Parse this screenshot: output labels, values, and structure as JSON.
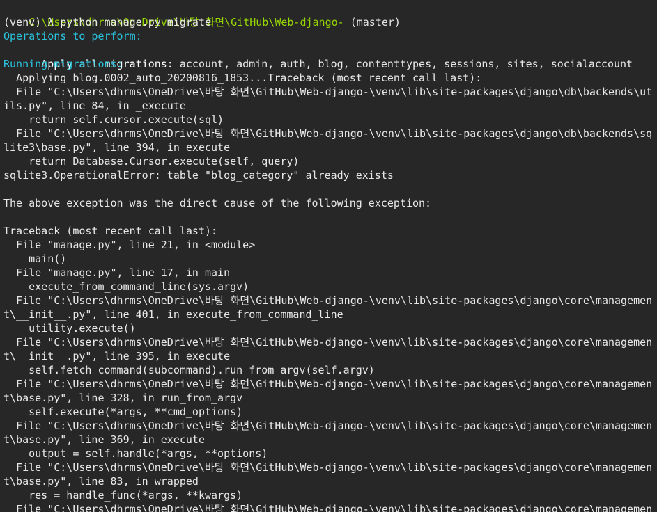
{
  "prompt": {
    "path": "C:\\Users\\dhrms\\OneDrive\\바탕 화면\\GitHub\\Web-django-",
    "branch": " (master)",
    "command": "(venv) λ python manage.py migrate"
  },
  "operations": {
    "heading": "Operations to perform:",
    "apply_label": "  Apply all migrations:",
    "apply_list": " account, admin, auth, blog, contenttypes, sessions, sites, socialaccount"
  },
  "running": {
    "heading": "Running migrations:"
  },
  "output_lines": [
    "  Applying blog.0002_auto_20200816_1853...Traceback (most recent call last):",
    "  File \"C:\\Users\\dhrms\\OneDrive\\바탕 화면\\GitHub\\Web-django-\\venv\\lib\\site-packages\\django\\db\\backends\\ut",
    "ils.py\", line 84, in _execute",
    "    return self.cursor.execute(sql)",
    "  File \"C:\\Users\\dhrms\\OneDrive\\바탕 화면\\GitHub\\Web-django-\\venv\\lib\\site-packages\\django\\db\\backends\\sq",
    "lite3\\base.py\", line 394, in execute",
    "    return Database.Cursor.execute(self, query)",
    "sqlite3.OperationalError: table \"blog_category\" already exists",
    "",
    "The above exception was the direct cause of the following exception:",
    "",
    "Traceback (most recent call last):",
    "  File \"manage.py\", line 21, in <module>",
    "    main()",
    "  File \"manage.py\", line 17, in main",
    "    execute_from_command_line(sys.argv)",
    "  File \"C:\\Users\\dhrms\\OneDrive\\바탕 화면\\GitHub\\Web-django-\\venv\\lib\\site-packages\\django\\core\\managemen",
    "t\\__init__.py\", line 401, in execute_from_command_line",
    "    utility.execute()",
    "  File \"C:\\Users\\dhrms\\OneDrive\\바탕 화면\\GitHub\\Web-django-\\venv\\lib\\site-packages\\django\\core\\managemen",
    "t\\__init__.py\", line 395, in execute",
    "    self.fetch_command(subcommand).run_from_argv(self.argv)",
    "  File \"C:\\Users\\dhrms\\OneDrive\\바탕 화면\\GitHub\\Web-django-\\venv\\lib\\site-packages\\django\\core\\managemen",
    "t\\base.py\", line 328, in run_from_argv",
    "    self.execute(*args, **cmd_options)",
    "  File \"C:\\Users\\dhrms\\OneDrive\\바탕 화면\\GitHub\\Web-django-\\venv\\lib\\site-packages\\django\\core\\managemen",
    "t\\base.py\", line 369, in execute",
    "    output = self.handle(*args, **options)",
    "  File \"C:\\Users\\dhrms\\OneDrive\\바탕 화면\\GitHub\\Web-django-\\venv\\lib\\site-packages\\django\\core\\managemen",
    "t\\base.py\", line 83, in wrapped",
    "    res = handle_func(*args, **kwargs)",
    "  File \"C:\\Users\\dhrms\\OneDrive\\바탕 화면\\GitHub\\Web-django-\\venv\\lib\\site-packages\\django\\core\\managemen"
  ],
  "colors": {
    "background": "#272727",
    "text": "#e8e8e8",
    "path": "#97d700",
    "heading": "#2ac3de"
  }
}
